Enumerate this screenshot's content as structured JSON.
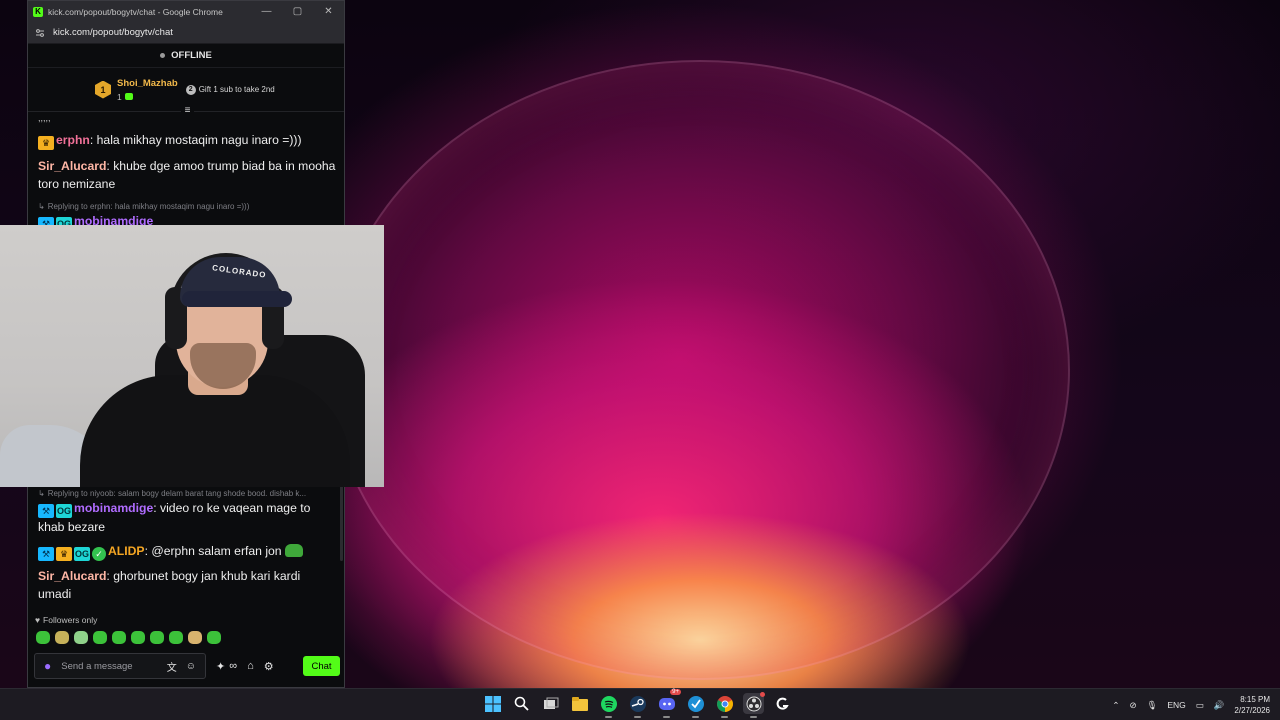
{
  "window": {
    "title": "kick.com/popout/bogytv/chat - Google Chrome",
    "url": "kick.com/popout/bogytv/chat",
    "controls": [
      "—",
      "▢",
      "✕"
    ]
  },
  "stream": {
    "status": "OFFLINE"
  },
  "leaderboard": {
    "rank": "1",
    "name": "Shoi_Mazhab",
    "count": "1",
    "gift_badge": "2",
    "gift_text": "Gift 1 sub to take 2nd"
  },
  "chat": {
    "top_fragment": ",,,,,",
    "messages": [
      {
        "user": "erphn",
        "text": ": hala mikhay mostaqim nagu inaro =)))"
      },
      {
        "user": "Sir_Alucard",
        "text": ": khube dge amoo trump biad ba in mooha toro nemizane"
      }
    ],
    "reply_1": "Replying to erphn: hala mikhay mostaqim nagu inaro =)))",
    "partial_user": "mobinamdige",
    "reply_2": "Replying to niyoob: salam bogy delam barat tang shode bood. dishab k...",
    "messages_bottom": [
      {
        "user": "mobinamdige",
        "text": ": video ro ke vaqean mage to khab bezare"
      },
      {
        "user": "ALIDP",
        "text": ": @erphn salam erfan jon"
      },
      {
        "user": "Sir_Alucard",
        "text": ": ghorbunet bogy jan khub kari kardi umadi"
      }
    ],
    "followers_only": "Followers only",
    "badges": {
      "og": "OG",
      "crown": "♛",
      "hammer": "⚒",
      "verify": "✓"
    }
  },
  "composer": {
    "placeholder": "Send a message",
    "chat_button": "Chat"
  },
  "webcam": {
    "cap_text": "COLORADO"
  },
  "taskbar": {
    "language": "ENG",
    "time": "8:15 PM",
    "date": "2/27/2026",
    "discord_badge": "9+"
  },
  "colors": {
    "kick_green": "#53fc18",
    "erphn": "#f07198",
    "sir_alucard": "#ffb7a6",
    "mobinamdige": "#b06cff",
    "alidp": "#f5a623"
  }
}
